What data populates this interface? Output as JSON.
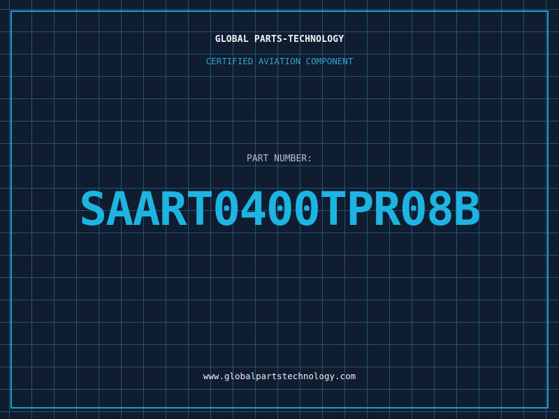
{
  "header": {
    "company": "GLOBAL PARTS-TECHNOLOGY",
    "subtitle": "CERTIFIED AVIATION COMPONENT"
  },
  "part": {
    "label": "PART NUMBER:",
    "number": "SAART0400TPR08B"
  },
  "footer": {
    "website": "www.globalpartstechnology.com"
  },
  "colors": {
    "background": "#101c30",
    "grid": "#266987",
    "border": "#1e9fcf",
    "accent": "#1eb4e2",
    "subtitle": "#2aa6cf",
    "label": "#b6bfca",
    "text": "#f2f4f7"
  }
}
